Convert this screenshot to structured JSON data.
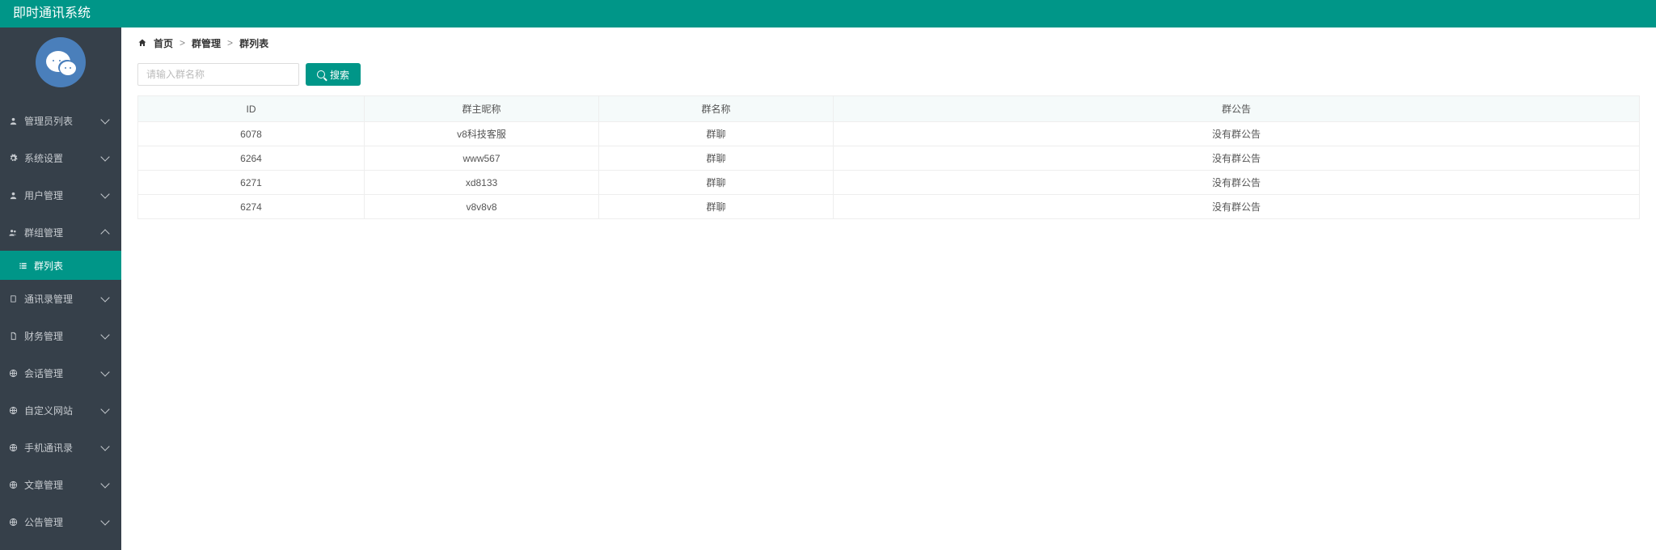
{
  "header": {
    "title": "即时通讯系统"
  },
  "breadcrumb": {
    "home": "首页",
    "section": "群管理",
    "page": "群列表"
  },
  "search": {
    "placeholder": "请输入群名称",
    "button": "搜索"
  },
  "sidebar": {
    "items": [
      {
        "icon": "user",
        "label": "管理员列表"
      },
      {
        "icon": "gear",
        "label": "系统设置"
      },
      {
        "icon": "user",
        "label": "用户管理"
      },
      {
        "icon": "users",
        "label": "群组管理",
        "expanded": true
      },
      {
        "icon": "book",
        "label": "通讯录管理"
      },
      {
        "icon": "doc",
        "label": "财务管理"
      },
      {
        "icon": "globe",
        "label": "会话管理"
      },
      {
        "icon": "globe",
        "label": "自定义网站"
      },
      {
        "icon": "globe",
        "label": "手机通讯录"
      },
      {
        "icon": "globe",
        "label": "文章管理"
      },
      {
        "icon": "globe",
        "label": "公告管理"
      }
    ],
    "sub": {
      "icon": "list",
      "label": "群列表"
    }
  },
  "table": {
    "columns": [
      "ID",
      "群主昵称",
      "群名称",
      "群公告"
    ],
    "rows": [
      {
        "id": "6078",
        "owner": "v8科技客服",
        "name": "群聊",
        "notice": "没有群公告"
      },
      {
        "id": "6264",
        "owner": "www567",
        "name": "群聊",
        "notice": "没有群公告"
      },
      {
        "id": "6271",
        "owner": "xd8133",
        "name": "群聊",
        "notice": "没有群公告"
      },
      {
        "id": "6274",
        "owner": "v8v8v8",
        "name": "群聊",
        "notice": "没有群公告"
      }
    ]
  }
}
